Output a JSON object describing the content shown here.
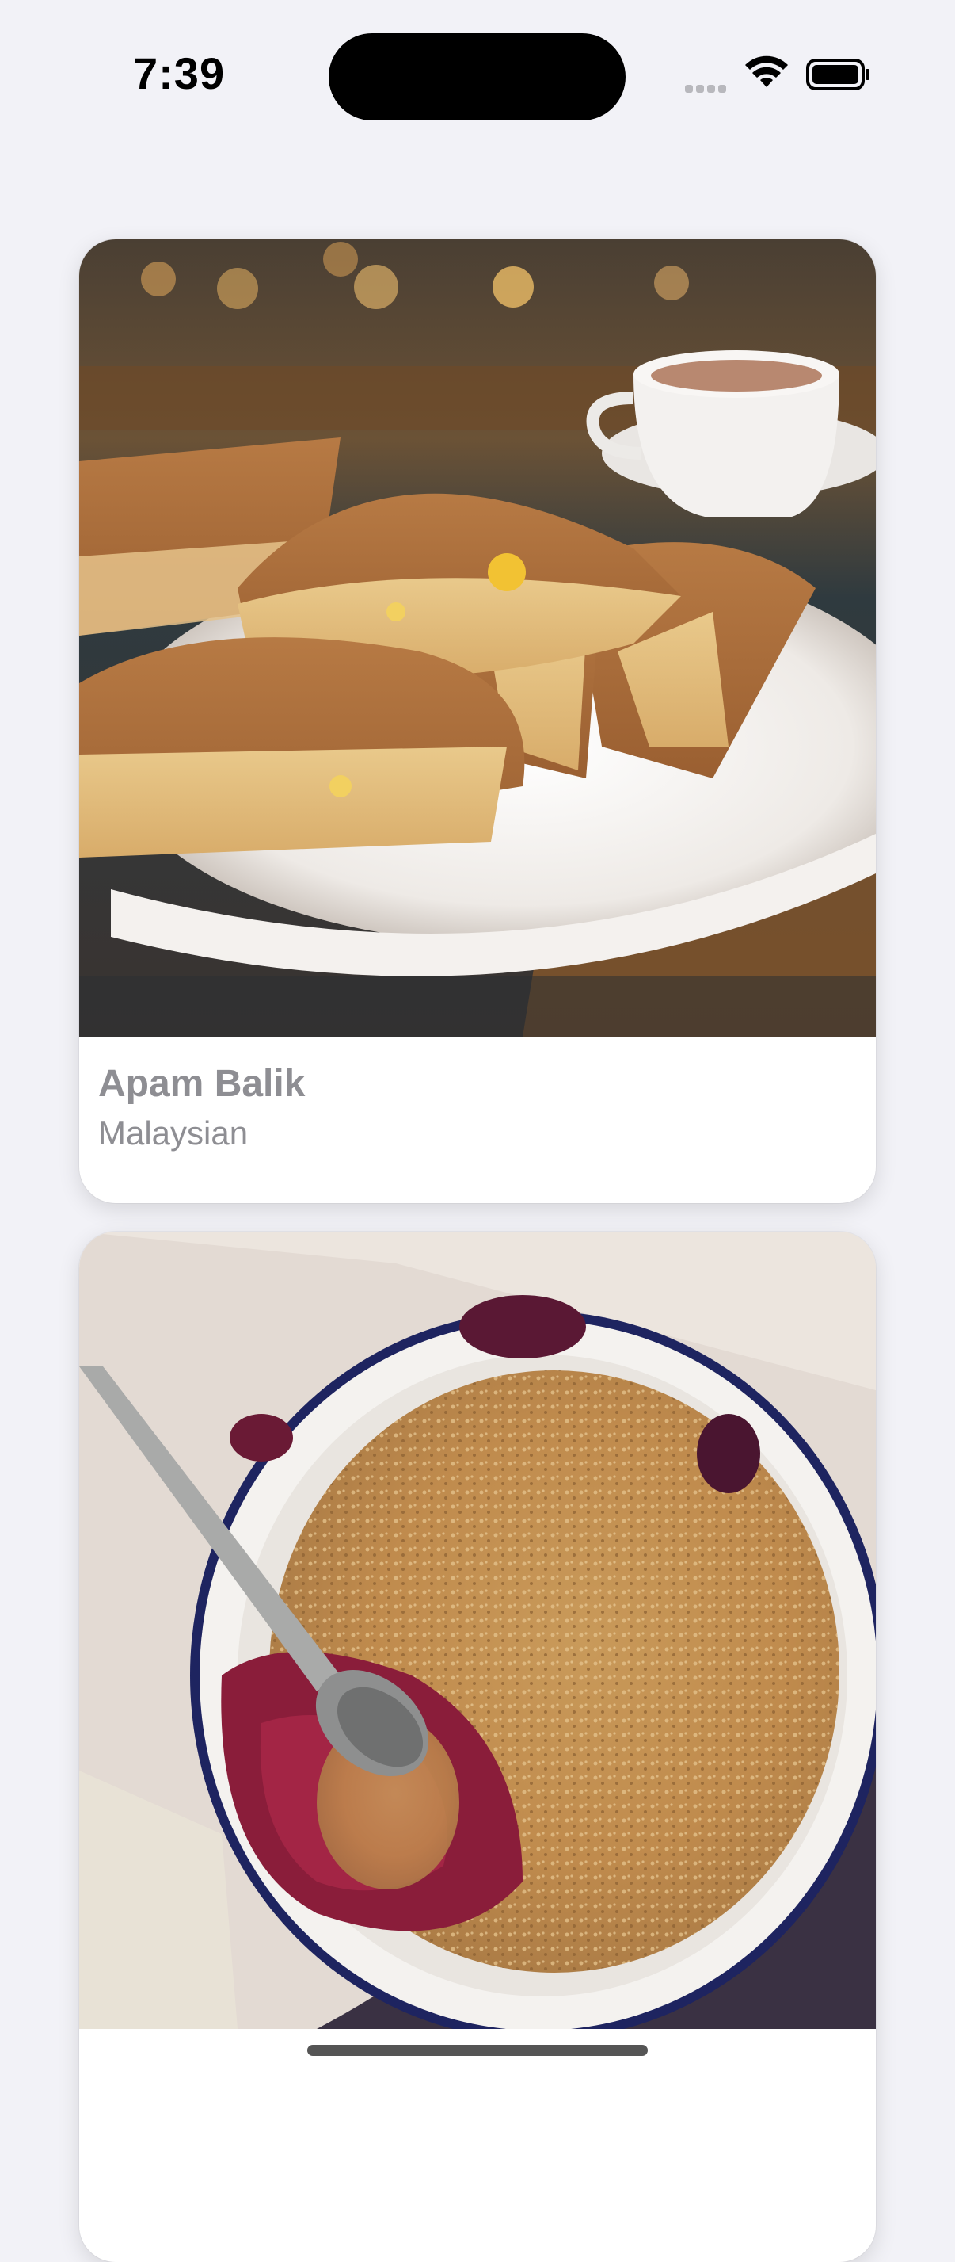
{
  "status_bar": {
    "time": "7:39",
    "icons": [
      "signal-dots-icon",
      "wifi-icon",
      "battery-icon"
    ]
  },
  "meals": [
    {
      "title": "Apam Balik",
      "area": "Malaysian",
      "image": "apam-balik-photo"
    },
    {
      "title": "",
      "area": "",
      "image": "berry-crumble-photo"
    }
  ],
  "colors": {
    "background": "#f2f2f7",
    "card": "#ffffff",
    "label": "#8e8e93"
  }
}
